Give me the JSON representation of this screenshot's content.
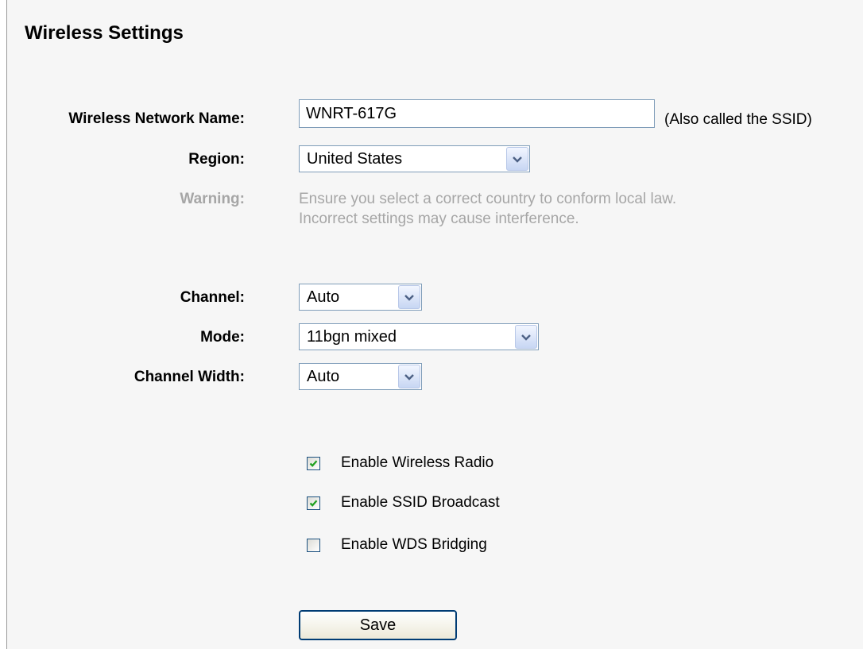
{
  "page": {
    "title": "Wireless Settings"
  },
  "form": {
    "ssid_label": "Wireless Network Name:",
    "ssid_value": "WNRT-617G",
    "ssid_hint": "(Also called the SSID)",
    "region_label": "Region:",
    "region_value": "United States",
    "warning_label": "Warning:",
    "warning_line1": "Ensure you select a correct country to conform local law.",
    "warning_line2": "Incorrect settings may cause interference.",
    "channel_label": "Channel:",
    "channel_value": "Auto",
    "mode_label": "Mode:",
    "mode_value": "11bgn mixed",
    "width_label": "Channel Width:",
    "width_value": "Auto"
  },
  "options": {
    "radio_label": "Enable Wireless Radio",
    "radio_checked": true,
    "ssid_broadcast_label": "Enable SSID Broadcast",
    "ssid_broadcast_checked": true,
    "wds_label": "Enable WDS Bridging",
    "wds_checked": false
  },
  "actions": {
    "save_label": "Save"
  },
  "icons": {
    "dropdown": "chevron-down-icon",
    "check": "checkmark-icon"
  },
  "colors": {
    "panel_bg": "#f6f6f6",
    "warning_text": "#a6a6a6",
    "field_border": "#7f9db9",
    "check_green": "#21a121",
    "button_border": "#003c74"
  }
}
